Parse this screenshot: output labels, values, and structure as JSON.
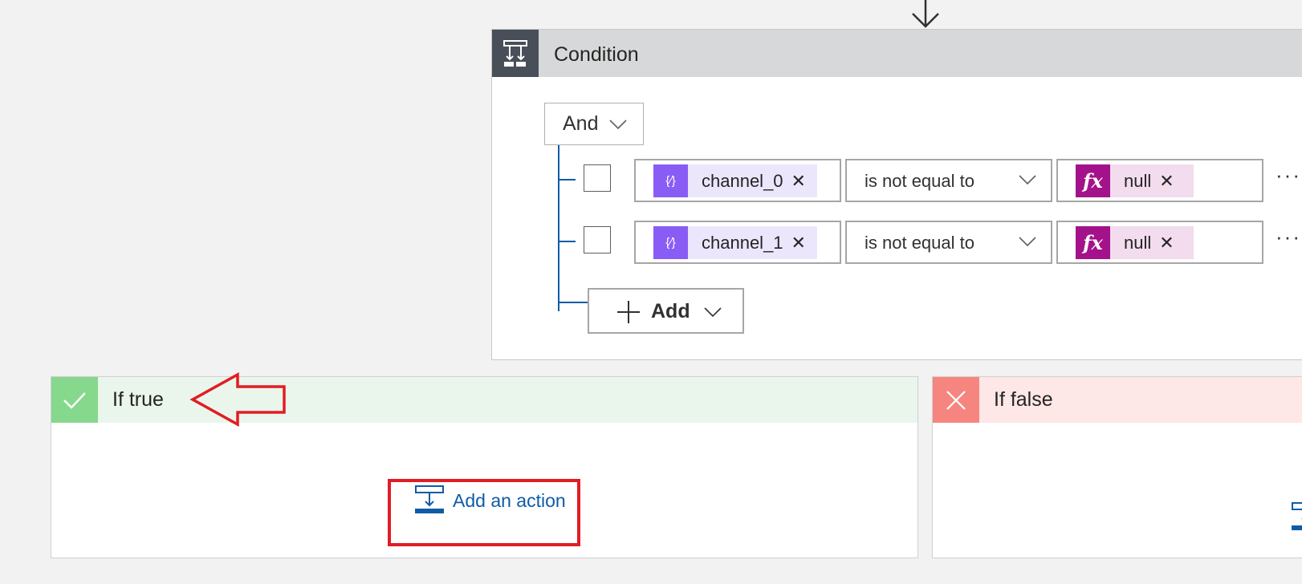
{
  "condition": {
    "title": "Condition",
    "logical_operator": "And",
    "rows": [
      {
        "left_token": "channel_0",
        "operator": "is not equal to",
        "right_token": "null"
      },
      {
        "left_token": "channel_1",
        "operator": "is not equal to",
        "right_token": "null"
      }
    ],
    "add_label": "Add",
    "more_options": "···"
  },
  "branches": {
    "true_title": "If true",
    "false_title": "If false",
    "add_action_label": "Add an action"
  },
  "token_icons": {
    "dynamic": "{⁄}",
    "expression": "fx"
  },
  "colors": {
    "condition_header": "#d7d8da",
    "condition_icon_bg": "#484f58",
    "dynamic_token": "#8a5cf6",
    "expression_token": "#a4128b",
    "true_accent": "#86d88c",
    "false_accent": "#f6857f",
    "link_blue": "#0f5ba8",
    "annotation_red": "#e11d23"
  }
}
